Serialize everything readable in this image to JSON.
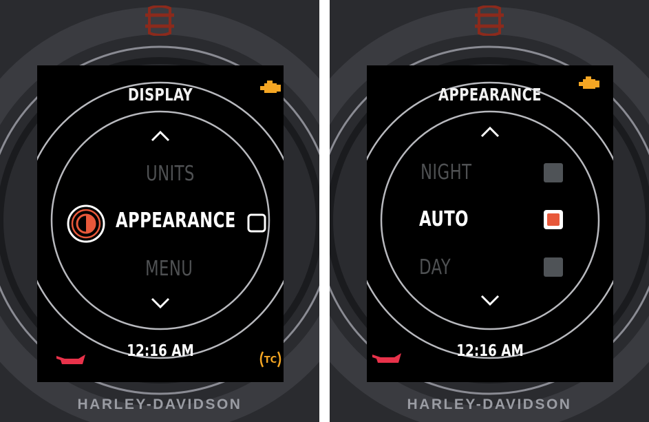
{
  "brand_text": "HARLEY-DAVIDSON",
  "clock": "12:16 AM",
  "colors": {
    "accent_orange": "#e8583a",
    "engine_icon": "#f5a623",
    "oil_icon": "#e8324a",
    "tc_icon": "#f5a623",
    "dim_text": "#4f5153",
    "ring": "#8a8b93"
  },
  "left_screen": {
    "title": "DISPLAY",
    "items": [
      {
        "label": "UNITS",
        "state": "dim"
      },
      {
        "label": "APPEARANCE",
        "state": "selected"
      },
      {
        "label": "MENU",
        "state": "dim"
      }
    ],
    "tc_label": "TC"
  },
  "right_screen": {
    "title": "APPEARANCE",
    "items": [
      {
        "label": "NIGHT",
        "state": "dim"
      },
      {
        "label": "AUTO",
        "state": "selected"
      },
      {
        "label": "DAY",
        "state": "dim"
      }
    ]
  }
}
